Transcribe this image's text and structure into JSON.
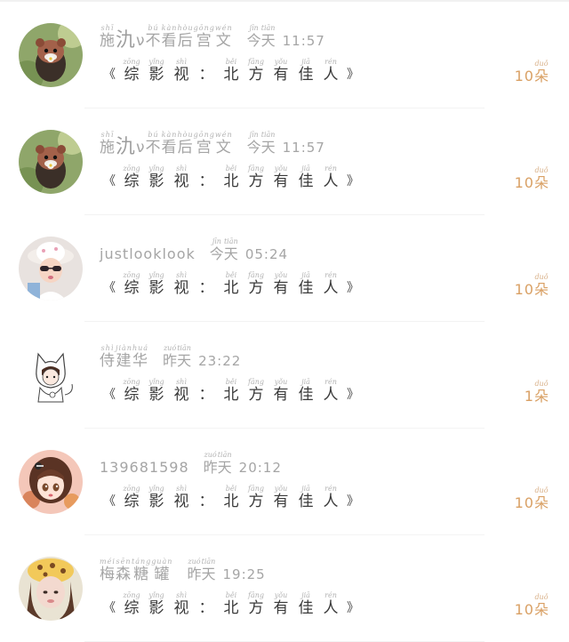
{
  "rows": [
    {
      "avatar": "hamster-flower-avatar",
      "nick_parts": [
        {
          "py": "shī",
          "hz": "施"
        },
        {
          "py": "",
          "hz": "氿",
          "big": true
        },
        {
          "py": "",
          "hz": "ν"
        },
        {
          "py": "bú",
          "hz": "不"
        },
        {
          "py": "kàn",
          "hz": "看"
        },
        {
          "py": "hòu",
          "hz": "后"
        },
        {
          "py": "gōng",
          "hz": "宫"
        },
        {
          "py": "wén",
          "hz": "文"
        }
      ],
      "day_parts": [
        {
          "py": "jīn",
          "hz": "今"
        },
        {
          "py": "tiān",
          "hz": "天"
        }
      ],
      "time": "11:57",
      "title_parts": [
        {
          "py": "zōng",
          "hz": "综"
        },
        {
          "py": "yǐng",
          "hz": "影"
        },
        {
          "py": "shì",
          "hz": "视"
        },
        {
          "py": "",
          "hz": "："
        },
        {
          "py": "běi",
          "hz": "北"
        },
        {
          "py": "fāng",
          "hz": "方"
        },
        {
          "py": "yǒu",
          "hz": "有"
        },
        {
          "py": "jiā",
          "hz": "佳"
        },
        {
          "py": "rén",
          "hz": "人"
        }
      ],
      "amount": "10",
      "unit": {
        "py": "duǒ",
        "hz": "朵"
      }
    },
    {
      "avatar": "hamster-flower-avatar",
      "nick_parts": [
        {
          "py": "shī",
          "hz": "施"
        },
        {
          "py": "",
          "hz": "氿",
          "big": true
        },
        {
          "py": "",
          "hz": "ν"
        },
        {
          "py": "bú",
          "hz": "不"
        },
        {
          "py": "kàn",
          "hz": "看"
        },
        {
          "py": "hòu",
          "hz": "后"
        },
        {
          "py": "gōng",
          "hz": "宫"
        },
        {
          "py": "wén",
          "hz": "文"
        }
      ],
      "day_parts": [
        {
          "py": "jīn",
          "hz": "今"
        },
        {
          "py": "tiān",
          "hz": "天"
        }
      ],
      "time": "11:57",
      "title_parts": [
        {
          "py": "zōng",
          "hz": "综"
        },
        {
          "py": "yǐng",
          "hz": "影"
        },
        {
          "py": "shì",
          "hz": "视"
        },
        {
          "py": "",
          "hz": "："
        },
        {
          "py": "běi",
          "hz": "北"
        },
        {
          "py": "fāng",
          "hz": "方"
        },
        {
          "py": "yǒu",
          "hz": "有"
        },
        {
          "py": "jiā",
          "hz": "佳"
        },
        {
          "py": "rén",
          "hz": "人"
        }
      ],
      "amount": "10",
      "unit": {
        "py": "duǒ",
        "hz": "朵"
      }
    },
    {
      "avatar": "girl-hat-sunglasses-avatar",
      "nick_text": "justlooklook",
      "day_parts": [
        {
          "py": "jīn",
          "hz": "今"
        },
        {
          "py": "tiān",
          "hz": "天"
        }
      ],
      "time": "05:24",
      "title_parts": [
        {
          "py": "zōng",
          "hz": "综"
        },
        {
          "py": "yǐng",
          "hz": "影"
        },
        {
          "py": "shì",
          "hz": "视"
        },
        {
          "py": "",
          "hz": "："
        },
        {
          "py": "běi",
          "hz": "北"
        },
        {
          "py": "fāng",
          "hz": "方"
        },
        {
          "py": "yǒu",
          "hz": "有"
        },
        {
          "py": "jiā",
          "hz": "佳"
        },
        {
          "py": "rén",
          "hz": "人"
        }
      ],
      "amount": "10",
      "unit": {
        "py": "duǒ",
        "hz": "朵"
      }
    },
    {
      "avatar": "cat-hood-sketch-avatar",
      "nick_parts": [
        {
          "py": "shì",
          "hz": "侍"
        },
        {
          "py": "jiàn",
          "hz": "建"
        },
        {
          "py": "huá",
          "hz": "华"
        }
      ],
      "day_parts": [
        {
          "py": "zuó",
          "hz": "昨"
        },
        {
          "py": "tiān",
          "hz": "天"
        }
      ],
      "time": "23:22",
      "title_parts": [
        {
          "py": "zōng",
          "hz": "综"
        },
        {
          "py": "yǐng",
          "hz": "影"
        },
        {
          "py": "shì",
          "hz": "视"
        },
        {
          "py": "",
          "hz": "："
        },
        {
          "py": "běi",
          "hz": "北"
        },
        {
          "py": "fāng",
          "hz": "方"
        },
        {
          "py": "yǒu",
          "hz": "有"
        },
        {
          "py": "jiā",
          "hz": "佳"
        },
        {
          "py": "rén",
          "hz": "人"
        }
      ],
      "amount": "1",
      "unit": {
        "py": "duǒ",
        "hz": "朵"
      }
    },
    {
      "avatar": "anime-girl-avatar",
      "nick_text": "139681598",
      "day_parts": [
        {
          "py": "zuó",
          "hz": "昨"
        },
        {
          "py": "tiān",
          "hz": "天"
        }
      ],
      "time": "20:12",
      "title_parts": [
        {
          "py": "zōng",
          "hz": "综"
        },
        {
          "py": "yǐng",
          "hz": "影"
        },
        {
          "py": "shì",
          "hz": "视"
        },
        {
          "py": "",
          "hz": "："
        },
        {
          "py": "běi",
          "hz": "北"
        },
        {
          "py": "fāng",
          "hz": "方"
        },
        {
          "py": "yǒu",
          "hz": "有"
        },
        {
          "py": "jiā",
          "hz": "佳"
        },
        {
          "py": "rén",
          "hz": "人"
        }
      ],
      "amount": "10",
      "unit": {
        "py": "duǒ",
        "hz": "朵"
      }
    },
    {
      "avatar": "girl-leopard-hat-avatar",
      "nick_parts": [
        {
          "py": "méi",
          "hz": "梅"
        },
        {
          "py": "sēn",
          "hz": "森"
        },
        {
          "py": "táng",
          "hz": "糖"
        },
        {
          "py": "guàn",
          "hz": "罐"
        }
      ],
      "day_parts": [
        {
          "py": "zuó",
          "hz": "昨"
        },
        {
          "py": "tiān",
          "hz": "天"
        }
      ],
      "time": "19:25",
      "title_parts": [
        {
          "py": "zōng",
          "hz": "综"
        },
        {
          "py": "yǐng",
          "hz": "影"
        },
        {
          "py": "shì",
          "hz": "视"
        },
        {
          "py": "",
          "hz": "："
        },
        {
          "py": "běi",
          "hz": "北"
        },
        {
          "py": "fāng",
          "hz": "方"
        },
        {
          "py": "yǒu",
          "hz": "有"
        },
        {
          "py": "jiā",
          "hz": "佳"
        },
        {
          "py": "rén",
          "hz": "人"
        }
      ],
      "amount": "10",
      "unit": {
        "py": "duǒ",
        "hz": "朵"
      }
    }
  ],
  "book_quote_open": "《",
  "book_quote_close": "》",
  "colors": {
    "meta_gray": "#a5a5a5",
    "title_dark": "#3a3a3a",
    "amount_orange": "#d9a064"
  }
}
